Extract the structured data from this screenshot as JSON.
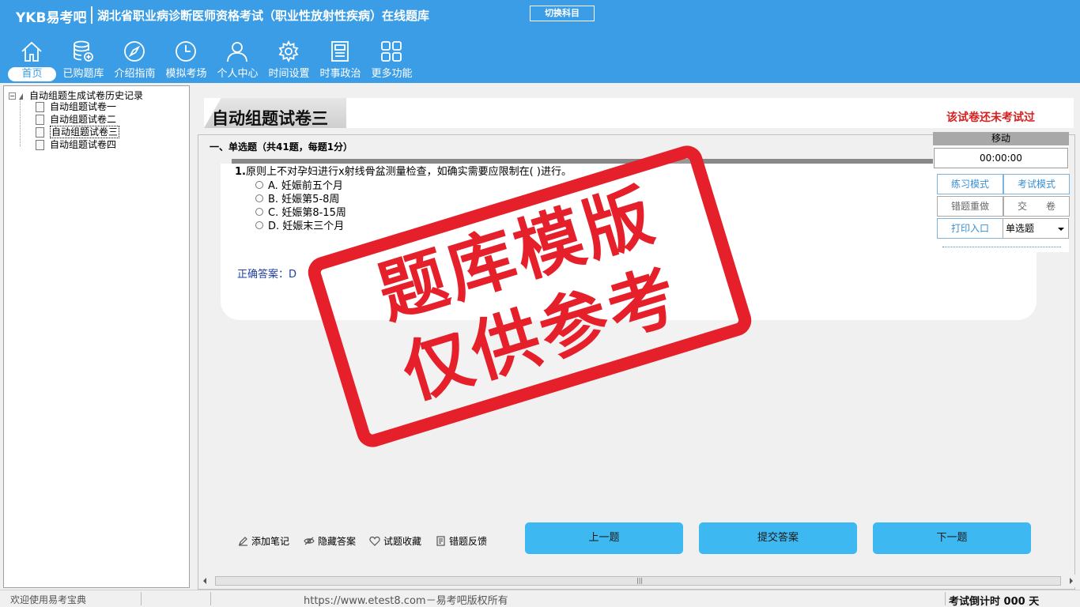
{
  "header": {
    "brand": "YKB易考吧",
    "app_title": "湖北省职业病诊断医师资格考试（职业性放射性疾病）在线题库",
    "switch_subject": "切换科目"
  },
  "nav": {
    "items": [
      {
        "label": "首页",
        "icon": "home-icon"
      },
      {
        "label": "已购题库",
        "icon": "database-icon"
      },
      {
        "label": "介绍指南",
        "icon": "compass-icon"
      },
      {
        "label": "模拟考场",
        "icon": "clock-icon"
      },
      {
        "label": "个人中心",
        "icon": "user-icon"
      },
      {
        "label": "时间设置",
        "icon": "gear-icon"
      },
      {
        "label": "时事政治",
        "icon": "newspaper-icon"
      },
      {
        "label": "更多功能",
        "icon": "grid-icon"
      }
    ]
  },
  "tree": {
    "root": "自动组题生成试卷历史记录",
    "items": [
      "自动组题试卷一",
      "自动组题试卷二",
      "自动组题试卷三",
      "自动组题试卷四"
    ],
    "selected": "自动组题试卷三"
  },
  "paper": {
    "title": "自动组题试卷三",
    "status": "该试卷还未考试过"
  },
  "section": {
    "heading": "一、单选题（共41题，每题1分）"
  },
  "question": {
    "number": "1.",
    "text": "原则上不对孕妇进行x射线骨盆测量检查，如确实需要应限制在( )进行。",
    "options": [
      "A. 妊娠前五个月",
      "B. 妊娠第5-8周",
      "C. 妊娠第8-15周",
      "D. 妊娠末三个月"
    ],
    "answer_label": "正确答案：",
    "answer_value": "D"
  },
  "control": {
    "header": "移动",
    "timer": "00:00:00",
    "practice_mode": "练习模式",
    "exam_mode": "考试模式",
    "redo_wrong": "错题重做",
    "submit_paper": "交　　卷",
    "print_entry": "打印入口",
    "question_type": "单选题"
  },
  "tools": {
    "add_note": "添加笔记",
    "hide_answer": "隐藏答案",
    "favorite": "试题收藏",
    "feedback": "错题反馈"
  },
  "buttons": {
    "prev": "上一题",
    "submit_answer": "提交答案",
    "next": "下一题"
  },
  "statusbar": {
    "welcome": "欢迎使用易考宝典",
    "copyright": "https://www.etest8.com－易考吧版权所有",
    "countdown": "考试倒计时 000 天"
  },
  "watermark": {
    "line1": "题库模版",
    "line2": "仅供参考"
  },
  "colors": {
    "header_bg": "#3a9de6",
    "button_blue": "#3eb8f0",
    "stamp_red": "#e5202a",
    "status_red": "#d62020"
  }
}
